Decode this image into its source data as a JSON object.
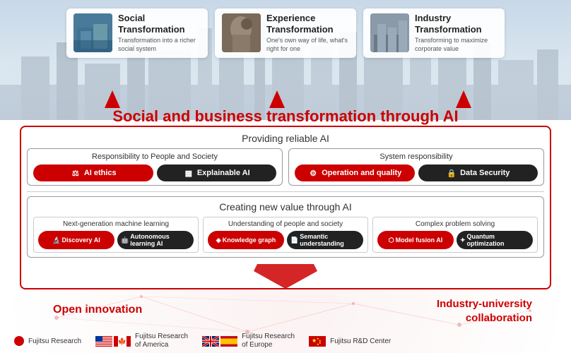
{
  "background": {
    "top_color": "#c8d8e8",
    "bottom_color": "#ffffff"
  },
  "top_cards": [
    {
      "id": "social",
      "title": "Social\nTransformation",
      "description": "Transformation into a richer social system",
      "img_class": "social"
    },
    {
      "id": "experience",
      "title": "Experience\nTransformation",
      "description": "One's own way of life, what's right for one",
      "img_class": "experience"
    },
    {
      "id": "industry",
      "title": "Industry\nTransformation",
      "description": "Transforming to maximize corporate value",
      "img_class": "industry"
    }
  ],
  "headline": "Social and business transformation through AI",
  "providing_section": {
    "title": "Providing reliable AI",
    "left_group": {
      "title": "Responsibility to People and Society",
      "pills": [
        {
          "label": "AI ethics",
          "style": "red",
          "icon": "⚖"
        },
        {
          "label": "Explainable AI",
          "style": "dark",
          "icon": "▦"
        }
      ]
    },
    "right_group": {
      "title": "System responsibility",
      "pills": [
        {
          "label": "Operation and quality",
          "style": "red",
          "icon": "⚙"
        },
        {
          "label": "Data Security",
          "style": "dark",
          "icon": "🔒"
        }
      ]
    }
  },
  "value_section": {
    "title": "Creating new value through AI",
    "columns": [
      {
        "title": "Next-generation machine learning",
        "pills": [
          {
            "label": "Discovery AI",
            "style": "red",
            "icon": "🔬"
          },
          {
            "label": "Autonomous learning AI",
            "style": "dark",
            "icon": "🤖"
          }
        ]
      },
      {
        "title": "Understanding of people and society",
        "pills": [
          {
            "label": "Knowledge graph",
            "style": "red",
            "icon": "◈"
          },
          {
            "label": "Semantic understanding",
            "style": "dark",
            "icon": "📄"
          }
        ]
      },
      {
        "title": "Complex problem solving",
        "pills": [
          {
            "label": "Model fusion AI",
            "style": "red",
            "icon": "⬡"
          },
          {
            "label": "Quantum optimization",
            "style": "dark",
            "icon": "✦"
          }
        ]
      }
    ]
  },
  "bottom": {
    "open_innovation": "Open innovation",
    "industry_collab": "Industry-university\ncollaboration",
    "logos": [
      {
        "name": "Fujitsu Research",
        "flags": [],
        "dot": true
      },
      {
        "name": "Fujitsu Research\nof America",
        "flags": [
          "us",
          "ca"
        ],
        "dot": false
      },
      {
        "name": "Fujitsu Research\nof Europe",
        "flags": [
          "uk",
          "es"
        ],
        "dot": false
      },
      {
        "name": "Fujitsu R&D Center",
        "flags": [
          "cn"
        ],
        "dot": false
      }
    ]
  }
}
